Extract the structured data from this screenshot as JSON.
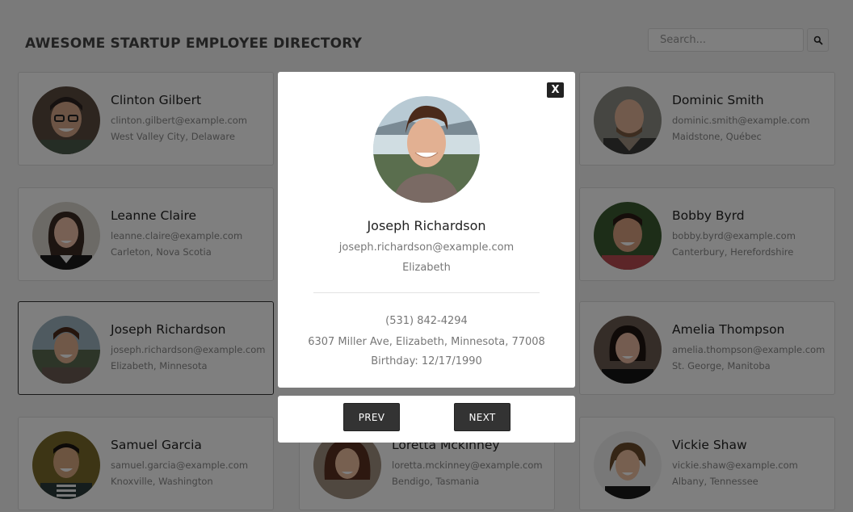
{
  "header": {
    "title": "AWESOME STARTUP EMPLOYEE DIRECTORY",
    "search_placeholder": "Search..."
  },
  "employees": [
    {
      "name": "Clinton Gilbert",
      "email": "clinton.gilbert@example.com",
      "location": "West Valley City, Delaware"
    },
    {
      "name": "Dominic Smith",
      "email": "dominic.smith@example.com",
      "location": "Maidstone, Québec"
    },
    {
      "name": "Leanne Claire",
      "email": "leanne.claire@example.com",
      "location": "Carleton, Nova Scotia"
    },
    {
      "name": "Bobby Byrd",
      "email": "bobby.byrd@example.com",
      "location": "Canterbury, Herefordshire"
    },
    {
      "name": "Joseph Richardson",
      "email": "joseph.richardson@example.com",
      "location": "Elizabeth, Minnesota"
    },
    {
      "name": "Amelia Thompson",
      "email": "amelia.thompson@example.com",
      "location": "St. George, Manitoba"
    },
    {
      "name": "Samuel Garcia",
      "email": "samuel.garcia@example.com",
      "location": "Knoxville, Washington"
    },
    {
      "name": "Loretta Mckinney",
      "email": "loretta.mckinney@example.com",
      "location": "Bendigo, Tasmania"
    },
    {
      "name": "Vickie Shaw",
      "email": "vickie.shaw@example.com",
      "location": "Albany, Tennessee"
    }
  ],
  "modal": {
    "close_label": "X",
    "name": "Joseph Richardson",
    "email": "joseph.richardson@example.com",
    "city": "Elizabeth",
    "phone": "(531) 842-4294",
    "address": "6307 Miller Ave, Elizabeth, Minnesota, 77008",
    "birthday": "Birthday: 12/17/1990",
    "prev_label": "PREV",
    "next_label": "NEXT"
  },
  "colors": {
    "overlay": "#000000",
    "button_bg": "#333333"
  }
}
